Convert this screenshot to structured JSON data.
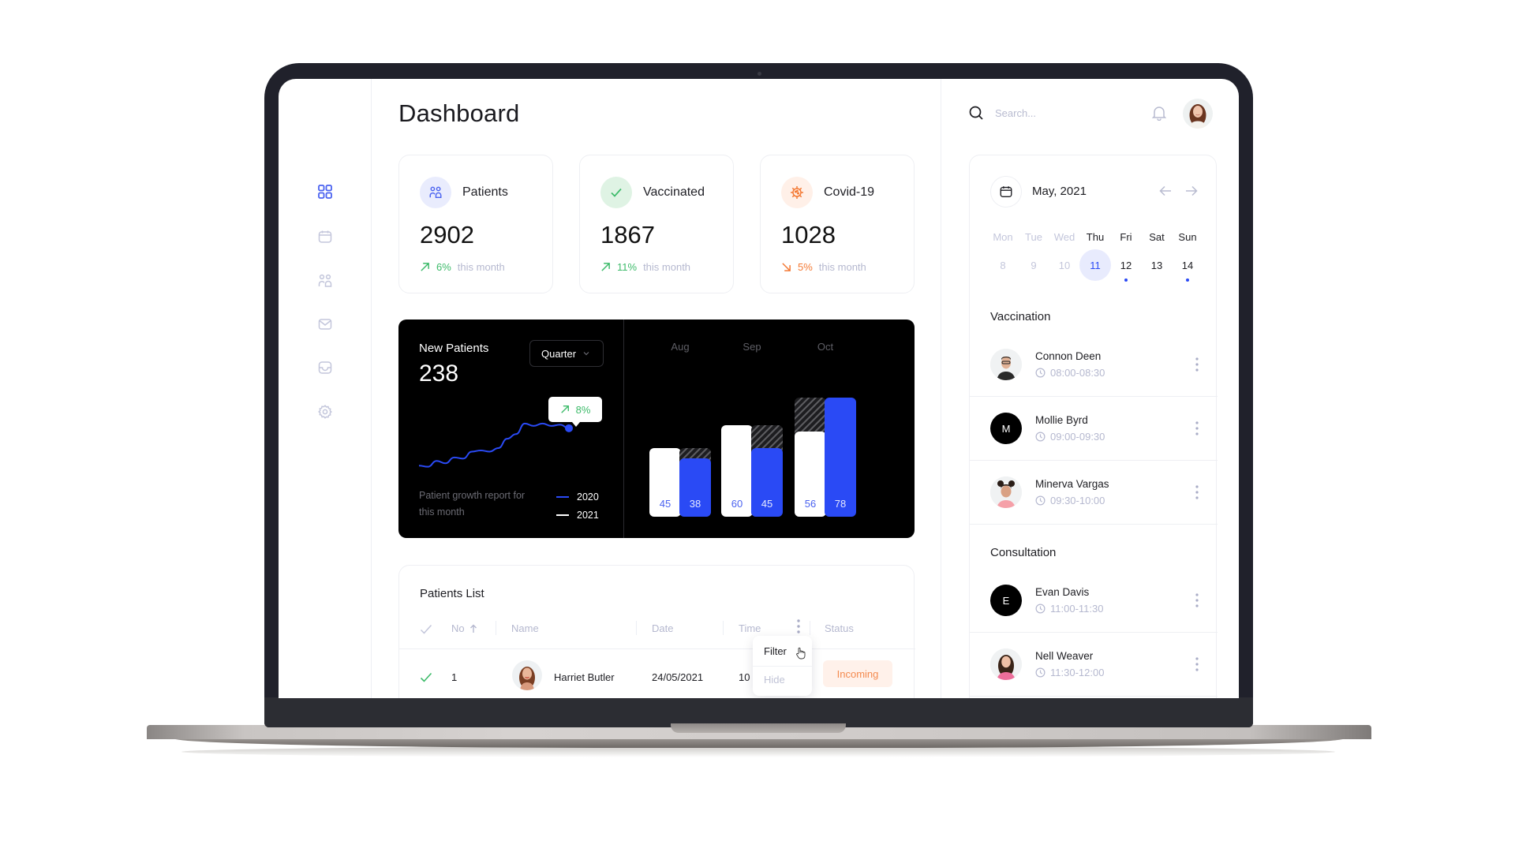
{
  "page": {
    "title": "Dashboard"
  },
  "sidebar": {
    "items": [
      {
        "name": "dashboard",
        "icon": "grid-icon",
        "active": true
      },
      {
        "name": "calendar",
        "icon": "calendar-icon",
        "active": false
      },
      {
        "name": "patients",
        "icon": "users-icon",
        "active": false
      },
      {
        "name": "messages",
        "icon": "mail-icon",
        "active": false
      },
      {
        "name": "inbox",
        "icon": "inbox-icon",
        "active": false
      },
      {
        "name": "settings",
        "icon": "gear-icon",
        "active": false
      }
    ]
  },
  "stats": [
    {
      "label": "Patients",
      "value": "2902",
      "change": "6%",
      "change_label": "this month",
      "direction": "up",
      "icon": "users-icon",
      "accent": "#4a62f0",
      "icon_bg": "#e9ecfd"
    },
    {
      "label": "Vaccinated",
      "value": "1867",
      "change": "11%",
      "change_label": "this month",
      "direction": "up",
      "icon": "check-icon",
      "accent": "#3dbb6a",
      "icon_bg": "#dff3e4"
    },
    {
      "label": "Covid-19",
      "value": "1028",
      "change": "5%",
      "change_label": "this month",
      "direction": "down",
      "icon": "virus-icon",
      "accent": "#f47a35",
      "icon_bg": "#fff0e8"
    }
  ],
  "new_patients": {
    "title": "New Patients",
    "value": "238",
    "period_select": "Quarter",
    "tooltip_change": "8%",
    "caption": "Patient growth report for this month",
    "legend": [
      {
        "label": "2020",
        "color": "#2a4af5"
      },
      {
        "label": "2021",
        "color": "#ffffff"
      }
    ]
  },
  "chart_data": [
    {
      "type": "line",
      "title": "New Patients",
      "series": [
        {
          "name": "2020",
          "values": [
            10,
            9,
            14,
            12,
            17,
            16,
            22,
            23,
            22,
            25,
            33,
            37,
            46,
            44,
            46,
            44,
            45,
            42
          ]
        }
      ],
      "annotation": "8%"
    },
    {
      "type": "bar",
      "categories": [
        "Aug",
        "Sep",
        "Oct"
      ],
      "series": [
        {
          "name": "2021",
          "values": [
            45,
            60,
            56
          ],
          "color": "#ffffff"
        },
        {
          "name": "2020",
          "values": [
            38,
            45,
            78
          ],
          "color": "#2a4af5"
        }
      ],
      "ylim": [
        0,
        80
      ],
      "grid": false
    }
  ],
  "patients_list": {
    "title": "Patients List",
    "columns": [
      "No",
      "Name",
      "Date",
      "Time",
      "Status"
    ],
    "rows": [
      {
        "no": "1",
        "name": "Harriet Butler",
        "date": "24/05/2021",
        "time": "10",
        "status": "Incoming",
        "checked": true
      }
    ],
    "column_menu": {
      "items": [
        "Filter",
        "Hide"
      ]
    }
  },
  "header": {
    "search_placeholder": "Search..."
  },
  "calendar": {
    "month": "May, 2021",
    "weekdays": [
      "Mon",
      "Tue",
      "Wed",
      "Thu",
      "Fri",
      "Sat",
      "Sun"
    ],
    "days": [
      {
        "d": "8",
        "muted": true,
        "dot": false
      },
      {
        "d": "9",
        "muted": true,
        "dot": false
      },
      {
        "d": "10",
        "muted": true,
        "dot": false
      },
      {
        "d": "11",
        "selected": true,
        "dot": false
      },
      {
        "d": "12",
        "dot": true
      },
      {
        "d": "13",
        "dot": false
      },
      {
        "d": "14",
        "dot": true
      }
    ]
  },
  "vaccination": {
    "title": "Vaccination",
    "items": [
      {
        "name": "Connon Deen",
        "time": "08:00-08:30",
        "avatar": "photo"
      },
      {
        "name": "Mollie Byrd",
        "time": "09:00-09:30",
        "avatar": "M"
      },
      {
        "name": "Minerva Vargas",
        "time": "09:30-10:00",
        "avatar": "photo"
      }
    ]
  },
  "consultation": {
    "title": "Consultation",
    "items": [
      {
        "name": "Evan Davis",
        "time": "11:00-11:30",
        "avatar": "E"
      },
      {
        "name": "Nell Weaver",
        "time": "11:30-12:00",
        "avatar": "photo"
      }
    ]
  }
}
